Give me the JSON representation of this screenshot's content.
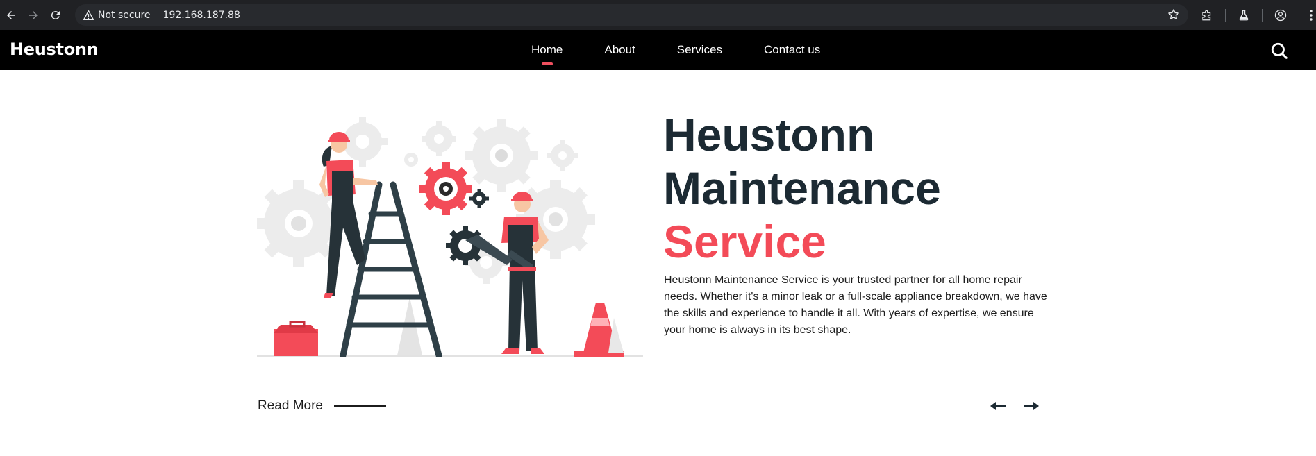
{
  "browser": {
    "security_label": "Not secure",
    "url": "192.168.187.88"
  },
  "site": {
    "logo": "Heustonn",
    "nav": [
      {
        "label": "Home",
        "active": true
      },
      {
        "label": "About",
        "active": false
      },
      {
        "label": "Services",
        "active": false
      },
      {
        "label": "Contact us",
        "active": false
      }
    ]
  },
  "hero": {
    "title_line1": "Heustonn",
    "title_line2": "Maintenance",
    "title_accent": "Service",
    "description": "Heustonn Maintenance Service is your trusted partner for all home repair needs. Whether it's a minor leak or a full-scale appliance breakdown, we have the skills and experience to handle it all. With years of expertise, we ensure your home is always in its best shape.",
    "read_more": "Read More"
  },
  "colors": {
    "accent": "#f34b58",
    "title": "#1c2a33",
    "header_bg": "#000000",
    "chrome_bg": "#202124"
  }
}
